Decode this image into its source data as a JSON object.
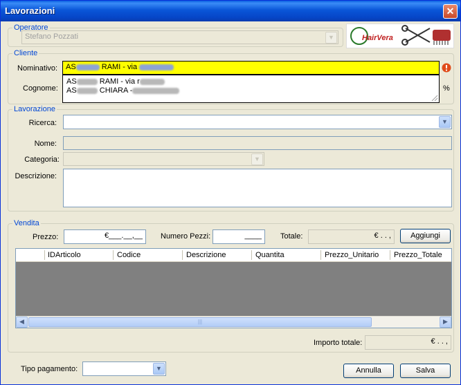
{
  "window": {
    "title": "Lavorazioni"
  },
  "operatore": {
    "legend": "Operatore",
    "value": "Stefano Pozzati"
  },
  "logo": {
    "text": "HairVera"
  },
  "cliente": {
    "legend": "Cliente",
    "nominativo_label": "Nominativo:",
    "nominativo_prefix": "AS",
    "nominativo_middle": "RAMI - via",
    "cognome_label": "Cognome:",
    "suggestions": [
      {
        "prefix": "AS",
        "middle": "RAMI - via r"
      },
      {
        "prefix": "AS",
        "middle": "CHIARA -"
      }
    ],
    "percent": "%"
  },
  "lavorazione": {
    "legend": "Lavorazione",
    "ricerca_label": "Ricerca:",
    "nome_label": "Nome:",
    "categoria_label": "Categoria:",
    "descrizione_label": "Descrizione:"
  },
  "vendita": {
    "legend": "Vendita",
    "prezzo_label": "Prezzo:",
    "prezzo_value": "€___.__,__",
    "numero_pezzi_label": "Numero Pezzi:",
    "numero_pezzi_value": "____",
    "totale_label": "Totale:",
    "totale_value": "€ . . ,",
    "aggiungi_label": "Aggiungi",
    "columns": [
      "IDArticolo",
      "Codice",
      "Descrizione",
      "Quantita",
      "Prezzo_Unitario",
      "Prezzo_Totale"
    ],
    "importo_totale_label": "Importo totale:",
    "importo_totale_value": "€ . . ,"
  },
  "footer": {
    "tipo_pagamento_label": "Tipo pagamento:",
    "annulla_label": "Annulla",
    "salva_label": "Salva"
  },
  "colors": {
    "title_bar": "#0a56d8",
    "legend": "#0046d5",
    "highlight": "#ffff00",
    "grid_body": "#808080"
  }
}
